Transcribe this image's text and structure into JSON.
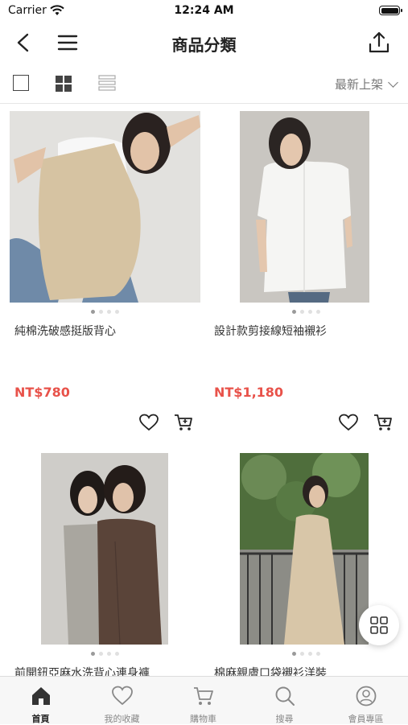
{
  "status": {
    "carrier": "Carrier",
    "time": "12:24 AM"
  },
  "nav": {
    "title": "商品分類"
  },
  "toolbar": {
    "sort_label": "最新上架"
  },
  "products": [
    {
      "name": "純棉洗破感挺版背心",
      "price": "NT$780"
    },
    {
      "name": "設計款剪接線短袖襯衫",
      "price": "NT$1,180"
    },
    {
      "name": "前開鈕亞麻水洗背心連身褲",
      "price": ""
    },
    {
      "name": "棉麻親膚口袋襯衫洋裝",
      "price": ""
    }
  ],
  "tabs": [
    {
      "label": "首頁",
      "icon": "home-icon",
      "active": true
    },
    {
      "label": "我的收藏",
      "icon": "heart-icon",
      "active": false
    },
    {
      "label": "購物車",
      "icon": "cart-icon",
      "active": false
    },
    {
      "label": "搜尋",
      "icon": "search-icon",
      "active": false
    },
    {
      "label": "會員專區",
      "icon": "user-icon",
      "active": false
    }
  ],
  "colors": {
    "price": "#e8524a",
    "accent": "#222222",
    "tab_inactive": "#888888"
  }
}
